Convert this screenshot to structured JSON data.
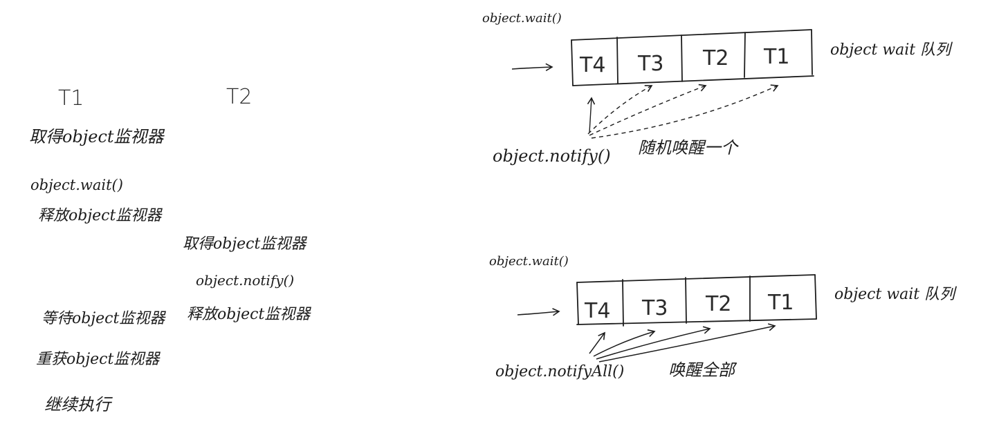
{
  "left": {
    "t1_header": "T1",
    "t2_header": "T2",
    "steps": {
      "t1_acquire": "取得object监视器",
      "t1_wait": "object.wait()",
      "t1_release": "释放object监视器",
      "t2_acquire": "取得object监视器",
      "t2_notify": "object.notify()",
      "t1_waiting": "等待object监视器",
      "t2_release": "释放object监视器",
      "t1_reacquire": "重获object监视器",
      "t1_continue": "继续执行"
    }
  },
  "top_diagram": {
    "wait_label": "object.wait()",
    "cells": [
      "T4",
      "T3",
      "T2",
      "T1"
    ],
    "queue_label": "object wait 队列",
    "notify_label": "object.notify()",
    "notify_desc": "随机唤醒一个"
  },
  "bottom_diagram": {
    "wait_label": "object.wait()",
    "cells": [
      "T4",
      "T3",
      "T2",
      "T1"
    ],
    "queue_label": "object wait 队列",
    "notify_label": "object.notifyAll()",
    "notify_desc": "唤醒全部"
  },
  "colors": {
    "ink": "#1c1c1c",
    "paper": "#ffffff"
  }
}
